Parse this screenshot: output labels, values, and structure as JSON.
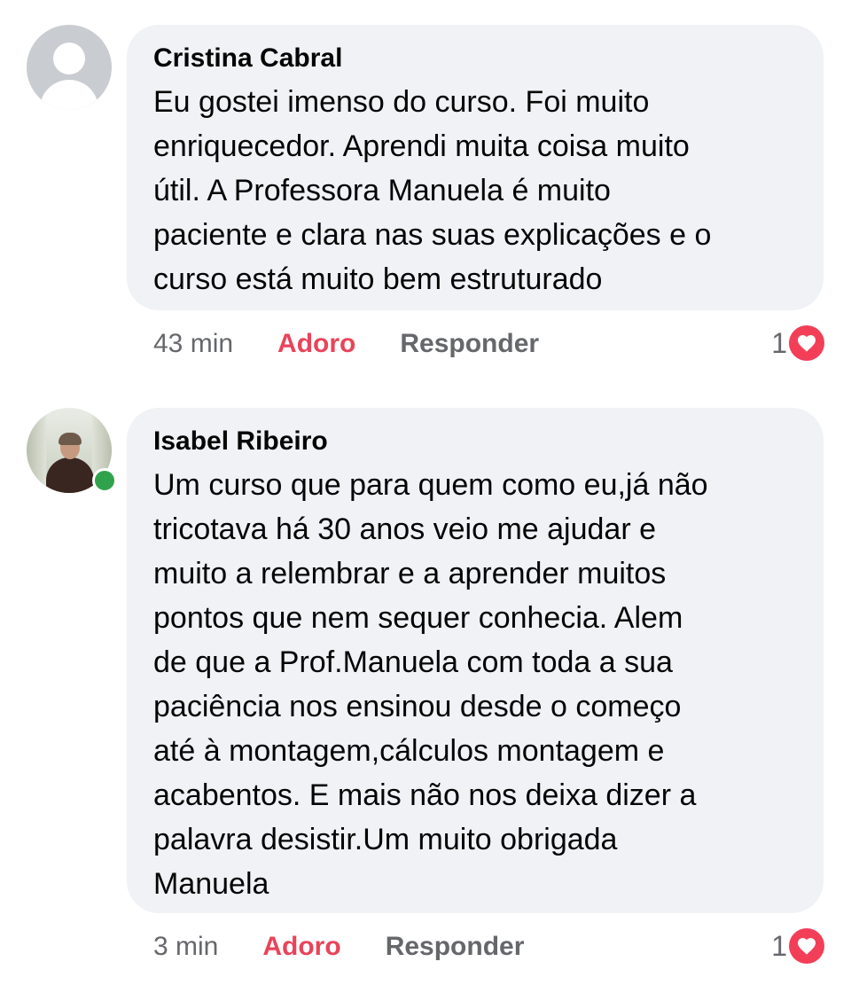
{
  "comments": [
    {
      "author": "Cristina Cabral",
      "text": "Eu gostei imenso do curso. Foi muito\nenriquecedor.  Aprendi muita coisa muito\nútil.  A Professora Manuela é muito\npaciente e clara nas suas explicações e o\ncurso está muito bem estruturado",
      "time": "43 min",
      "reaction_label": "Adoro",
      "reply_label": "Responder",
      "reaction_count": "1",
      "reaction_icon": "love-icon",
      "avatar": "default-profile-icon",
      "online": false
    },
    {
      "author": "Isabel Ribeiro",
      "text": "Um curso que para quem como eu,já  não\ntricotava há  30 anos veio me ajudar e\nmuito a relembrar  e a aprender muitos\npontos que nem sequer conhecia. Alem\nde que a Prof.Manuela com toda a sua\npaciência nos ensinou desde o começo\naté  à  montagem,cálculos  montagem e\nacabentos. E mais não  nos deixa dizer a\npalavra desistir.Um muito obrigada\nManuela",
      "time": "3 min",
      "reaction_label": "Adoro",
      "reply_label": "Responder",
      "reaction_count": "1",
      "reaction_icon": "love-icon",
      "avatar": "profile-photo",
      "online": true
    }
  ],
  "colors": {
    "bubble_bg": "#f0f2f5",
    "reaction_accent": "#e8445a",
    "love_icon": "#f33e58",
    "online": "#31a24c",
    "meta_text": "#65676b"
  }
}
